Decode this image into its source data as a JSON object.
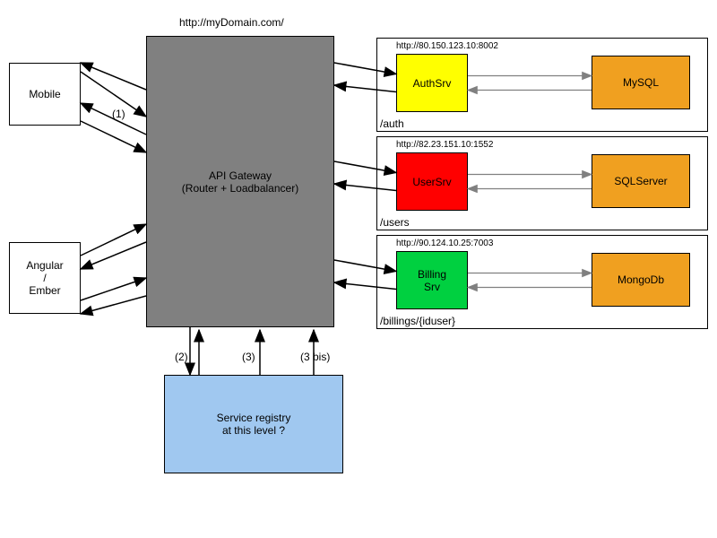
{
  "title_url": "http://myDomain.com/",
  "clients": {
    "mobile": "Mobile",
    "angular": "Angular\n/\nEmber"
  },
  "gateway": "API Gateway\n(Router + Loadbalancer)",
  "registry": "Service registry\nat this level ?",
  "lanes": [
    {
      "url": "http://80.150.123.10:8002",
      "srv_name": "AuthSrv",
      "srv_color": "#ffff00",
      "db_name": "MySQL",
      "db_color": "#f0a020",
      "path": "/auth"
    },
    {
      "url": "http://82.23.151.10:1552",
      "srv_name": "UserSrv",
      "srv_color": "#ff0000",
      "db_name": "SQLServer",
      "db_color": "#f0a020",
      "path": "/users"
    },
    {
      "url": "http://90.124.10.25:7003",
      "srv_name": "Billing\nSrv",
      "srv_color": "#00d040",
      "db_name": "MongoDb",
      "db_color": "#f0a020",
      "path": "/billings/{iduser}"
    }
  ],
  "edge_labels": {
    "one": "(1)",
    "two": "(2)",
    "three": "(3)",
    "three_bis": "(3 bis)"
  },
  "chart_data": {
    "type": "diagram",
    "nodes": [
      {
        "id": "mobile",
        "label": "Mobile"
      },
      {
        "id": "angular",
        "label": "Angular / Ember"
      },
      {
        "id": "gateway",
        "label": "API Gateway (Router + Loadbalancer)",
        "url": "http://myDomain.com/"
      },
      {
        "id": "registry",
        "label": "Service registry at this level ?"
      },
      {
        "id": "authsrv",
        "label": "AuthSrv",
        "url": "http://80.150.123.10:8002",
        "path": "/auth"
      },
      {
        "id": "mysql",
        "label": "MySQL"
      },
      {
        "id": "usersrv",
        "label": "UserSrv",
        "url": "http://82.23.151.10:1552",
        "path": "/users"
      },
      {
        "id": "sqlserver",
        "label": "SQLServer"
      },
      {
        "id": "billingsrv",
        "label": "Billing Srv",
        "url": "http://90.124.10.25:7003",
        "path": "/billings/{iduser}"
      },
      {
        "id": "mongodb",
        "label": "MongoDb"
      }
    ],
    "edges": [
      {
        "from": "mobile",
        "to": "gateway",
        "bidir": true,
        "label": "(1)"
      },
      {
        "from": "angular",
        "to": "gateway",
        "bidir": true
      },
      {
        "from": "gateway",
        "to": "registry",
        "bidir": true,
        "label": "(2)"
      },
      {
        "from": "registry",
        "to": "gateway",
        "label": "(3)"
      },
      {
        "from": "registry",
        "to": "gateway",
        "label": "(3 bis)"
      },
      {
        "from": "gateway",
        "to": "authsrv",
        "bidir": true
      },
      {
        "from": "authsrv",
        "to": "mysql",
        "bidir": true
      },
      {
        "from": "gateway",
        "to": "usersrv",
        "bidir": true
      },
      {
        "from": "usersrv",
        "to": "sqlserver",
        "bidir": true
      },
      {
        "from": "gateway",
        "to": "billingsrv",
        "bidir": true
      },
      {
        "from": "billingsrv",
        "to": "mongodb",
        "bidir": true
      }
    ]
  }
}
